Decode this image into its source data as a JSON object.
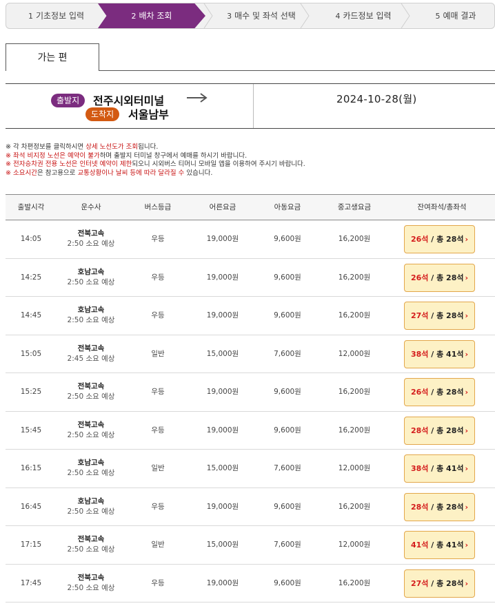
{
  "steps": [
    {
      "num": "1",
      "label": "기초정보 입력"
    },
    {
      "num": "2",
      "label": "배차 조회"
    },
    {
      "num": "3",
      "label": "매수 및 좌석 선택"
    },
    {
      "num": "4",
      "label": "카드정보 입력"
    },
    {
      "num": "5",
      "label": "예매 결과"
    }
  ],
  "tab": {
    "label": "가는 편"
  },
  "route": {
    "dep_badge": "출발지",
    "arr_badge": "도착지",
    "departure": "전주시외터미널",
    "arrival": "서울남부",
    "date": "2024-10-28(월)"
  },
  "notices": [
    {
      "pre": "※ 각 차편정보를 클릭하시면 ",
      "hl": "상세 노선도가 조회",
      "post": "됩니다."
    },
    {
      "pre": "※ ",
      "hl": "좌석 비지정 노선은 예약이 불가",
      "post": "하며 출발지 터미널 창구에서 예매를 하시기 바랍니다."
    },
    {
      "pre": "※ ",
      "hl": "전자승차권 전용 노선은 인터넷 예약이 제한",
      "post": "되오니 시외버스 티머니 모바일 앱을 이용하여 주시기 바랍니다."
    },
    {
      "pre": "※ ",
      "hl": "소요시간",
      "post": "은 참고용으로 ",
      "hl2": "교통상황이나 날씨 등에 따라 달라질 수",
      "post2": " 있습니다."
    }
  ],
  "table": {
    "headers": {
      "time": "출발시각",
      "company": "운수사",
      "grade": "버스등급",
      "adult": "어른요금",
      "child": "아동요금",
      "student": "중고생요금",
      "seats": "잔여좌석/총좌석"
    },
    "rows": [
      {
        "time": "14:05",
        "company": "전북고속",
        "duration": "2:50 소요 예상",
        "grade": "우등",
        "adult": "19,000원",
        "child": "9,600원",
        "student": "16,200원",
        "remaining": "26석",
        "total": "/ 총 28석"
      },
      {
        "time": "14:25",
        "company": "호남고속",
        "duration": "2:50 소요 예상",
        "grade": "우등",
        "adult": "19,000원",
        "child": "9,600원",
        "student": "16,200원",
        "remaining": "26석",
        "total": "/ 총 28석"
      },
      {
        "time": "14:45",
        "company": "호남고속",
        "duration": "2:50 소요 예상",
        "grade": "우등",
        "adult": "19,000원",
        "child": "9,600원",
        "student": "16,200원",
        "remaining": "27석",
        "total": "/ 총 28석"
      },
      {
        "time": "15:05",
        "company": "전북고속",
        "duration": "2:45 소요 예상",
        "grade": "일반",
        "adult": "15,000원",
        "child": "7,600원",
        "student": "12,000원",
        "remaining": "38석",
        "total": "/ 총 41석"
      },
      {
        "time": "15:25",
        "company": "전북고속",
        "duration": "2:50 소요 예상",
        "grade": "우등",
        "adult": "19,000원",
        "child": "9,600원",
        "student": "16,200원",
        "remaining": "26석",
        "total": "/ 총 28석"
      },
      {
        "time": "15:45",
        "company": "전북고속",
        "duration": "2:50 소요 예상",
        "grade": "우등",
        "adult": "19,000원",
        "child": "9,600원",
        "student": "16,200원",
        "remaining": "28석",
        "total": "/ 총 28석"
      },
      {
        "time": "16:15",
        "company": "호남고속",
        "duration": "2:50 소요 예상",
        "grade": "일반",
        "adult": "15,000원",
        "child": "7,600원",
        "student": "12,000원",
        "remaining": "38석",
        "total": "/ 총 41석"
      },
      {
        "time": "16:45",
        "company": "호남고속",
        "duration": "2:50 소요 예상",
        "grade": "우등",
        "adult": "19,000원",
        "child": "9,600원",
        "student": "16,200원",
        "remaining": "28석",
        "total": "/ 총 28석"
      },
      {
        "time": "17:15",
        "company": "전북고속",
        "duration": "2:50 소요 예상",
        "grade": "일반",
        "adult": "15,000원",
        "child": "7,600원",
        "student": "12,000원",
        "remaining": "41석",
        "total": "/ 총 41석"
      },
      {
        "time": "17:45",
        "company": "전북고속",
        "duration": "2:50 소요 예상",
        "grade": "우등",
        "adult": "19,000원",
        "child": "9,600원",
        "student": "16,200원",
        "remaining": "27석",
        "total": "/ 총 28석"
      }
    ]
  },
  "colors": {
    "active_step": "#7b2c7f",
    "departure_badge": "#7b2c7f",
    "arrival_badge": "#d35a12",
    "seat_highlight": "#d41c1c",
    "seat_button_bg": "#fdf1c5"
  }
}
